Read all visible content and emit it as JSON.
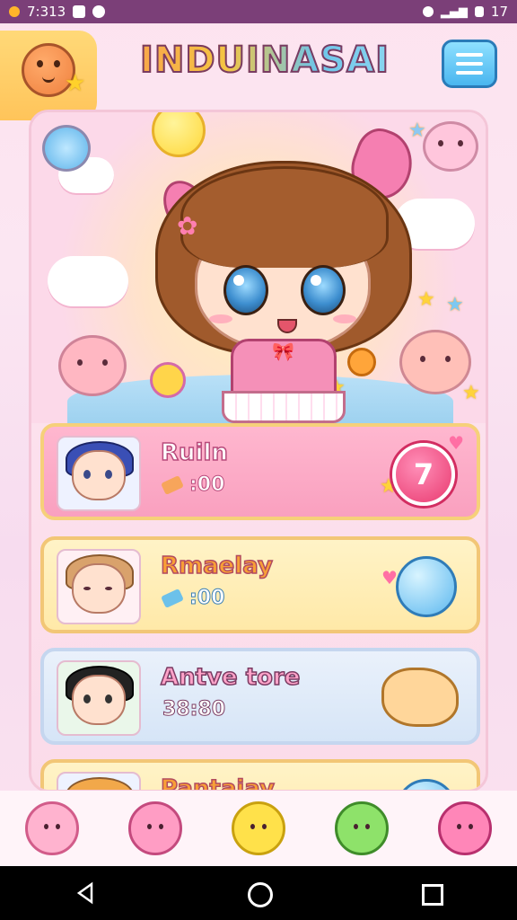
{
  "status_bar": {
    "time": "7:313",
    "right_text": "17"
  },
  "header": {
    "title": "INDUINASAI",
    "menu_icon": "hamburger-icon",
    "logo_icon": "smiling-critter-logo"
  },
  "cards": [
    {
      "title": "Ruiln",
      "stat": ":00",
      "stat_icon": "bandage-icon",
      "stat_icon_color": "#f7a55b",
      "badge": "7",
      "badge_type": "number"
    },
    {
      "title": "Rmaelay",
      "stat": ":00",
      "stat_icon": "eraser-icon",
      "stat_icon_color": "#6cc1ea",
      "badge_type": "bubble"
    },
    {
      "title": "Antve tore",
      "stat": "38:80",
      "badge_type": "puppy"
    },
    {
      "title": "Pantaiay",
      "badge_type": "bubble"
    }
  ],
  "bottom_nav": [
    {
      "name": "pink-critter",
      "color": "#ffb3cf",
      "border": "#d25c8a"
    },
    {
      "name": "pink-bunny",
      "color": "#ff9dc4",
      "border": "#c44a7e"
    },
    {
      "name": "yellow-chick",
      "color": "#ffe14a",
      "border": "#c9a10f"
    },
    {
      "name": "green-dino",
      "color": "#8ee26a",
      "border": "#3f8c2a"
    },
    {
      "name": "pink-strawberry",
      "color": "#ff86b8",
      "border": "#b8306e"
    }
  ],
  "colors": {
    "status_bar": "#7b3f78",
    "accent_pink": "#f57fb1",
    "accent_blue": "#4ab6ef"
  }
}
